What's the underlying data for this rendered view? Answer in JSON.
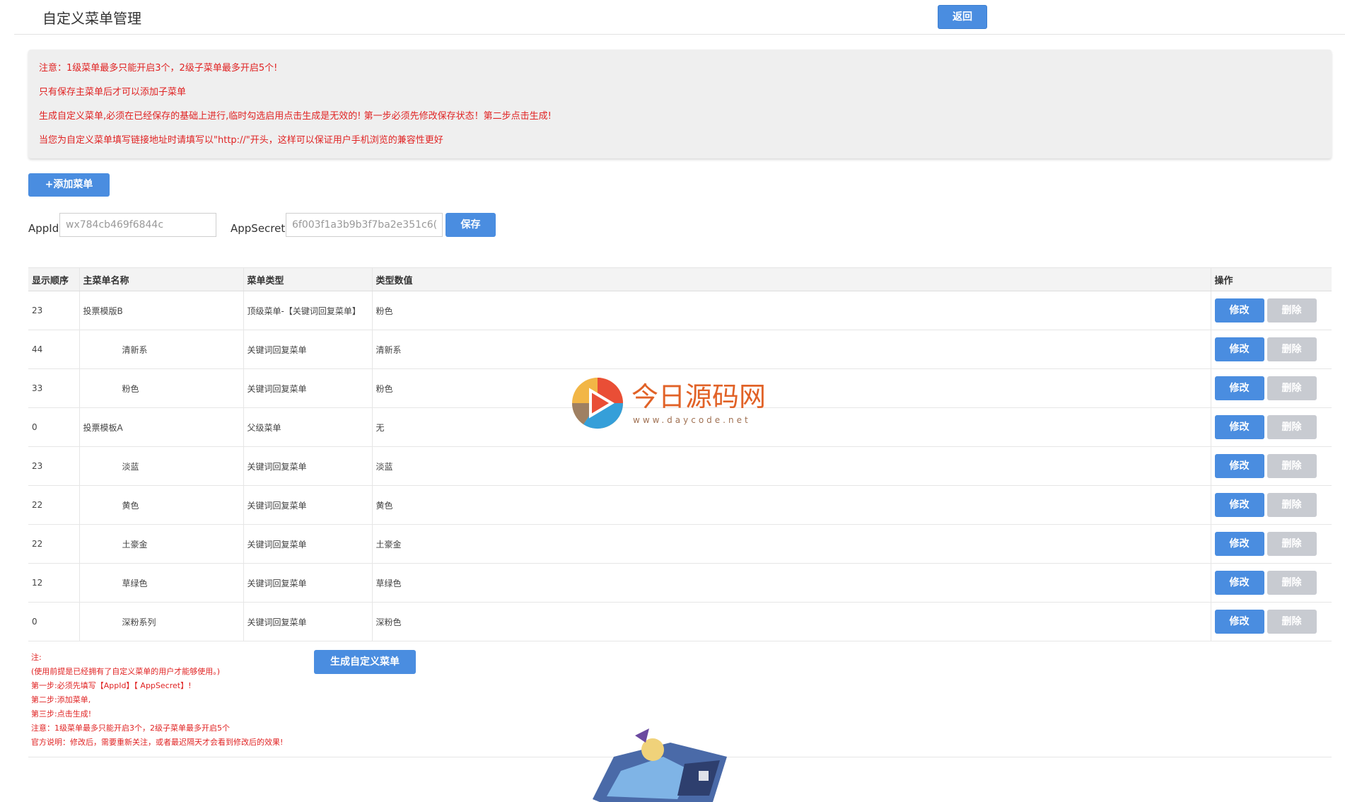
{
  "header": {
    "title": "自定义菜单管理",
    "back_label": "返回"
  },
  "notice": {
    "lines": [
      "注意：1级菜单最多只能开启3个，2级子菜单最多开启5个!",
      "只有保存主菜单后才可以添加子菜单",
      "生成自定义菜单,必须在已经保存的基础上进行,临时勾选启用点击生成是无效的! 第一步必须先修改保存状态！第二步点击生成!",
      "当您为自定义菜单填写链接地址时请填写以\"http://\"开头，这样可以保证用户手机浏览的兼容性更好"
    ]
  },
  "toolbar": {
    "add_label": "+添加菜单"
  },
  "credentials": {
    "appid_label": "AppId:",
    "appid_value": "wx784cb469f6844c",
    "appsecret_label": "AppSecret:",
    "appsecret_value": "6f003f1a3b9b3f7ba2e351c6(",
    "save_label": "保存"
  },
  "table": {
    "headers": [
      "显示顺序",
      "主菜单名称",
      "菜单类型",
      "类型数值",
      "操作"
    ],
    "edit_label": "修改",
    "delete_label": "删除",
    "rows": [
      {
        "order": "23",
        "name": "投票模版B",
        "type": "顶级菜单-【关键词回复菜单】",
        "value": "粉色"
      },
      {
        "order": "44",
        "name": "清新系",
        "type": "关键词回复菜单",
        "value": "清新系"
      },
      {
        "order": "33",
        "name": "粉色",
        "type": "关键词回复菜单",
        "value": "粉色"
      },
      {
        "order": "0",
        "name": "投票模板A",
        "type": "父级菜单",
        "value": "无"
      },
      {
        "order": "23",
        "name": "淡蓝",
        "type": "关键词回复菜单",
        "value": "淡蓝"
      },
      {
        "order": "22",
        "name": "黄色",
        "type": "关键词回复菜单",
        "value": "黄色"
      },
      {
        "order": "22",
        "name": "土豪金",
        "type": "关键词回复菜单",
        "value": "土豪金"
      },
      {
        "order": "12",
        "name": "草绿色",
        "type": "关键词回复菜单",
        "value": "草绿色"
      },
      {
        "order": "0",
        "name": "深粉系列",
        "type": "关键词回复菜单",
        "value": "深粉色"
      }
    ]
  },
  "footer": {
    "generate_label": "生成自定义菜单",
    "notes": [
      "注:",
      "(使用前提是已经拥有了自定义菜单的用户才能够使用。)",
      "第一步:必须先填写【AppId】【 AppSecret】!",
      "第二步:添加菜单,",
      "第三步:点击生成!",
      "注意：1级菜单最多只能开启3个，2级子菜单最多开启5个",
      "官方说明：修改后，需要重新关注，或者最迟隔天才会看到修改后的效果!"
    ]
  },
  "watermark": {
    "title": "今日源码网",
    "url": "www.daycode.net"
  },
  "colors": {
    "accent": "#4a8de0",
    "warning": "#e02323",
    "disabled": "#c8cbd1"
  }
}
